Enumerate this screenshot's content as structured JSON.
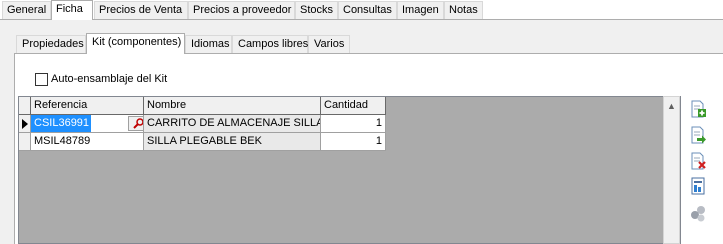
{
  "top_tabs": [
    {
      "label": "General"
    },
    {
      "label": "Ficha"
    },
    {
      "label": "Precios de Venta"
    },
    {
      "label": "Precios a proveedor"
    },
    {
      "label": "Stocks"
    },
    {
      "label": "Consultas"
    },
    {
      "label": "Imagen"
    },
    {
      "label": "Notas"
    }
  ],
  "inner_tabs": [
    {
      "label": "Propiedades"
    },
    {
      "label": "Kit (componentes)"
    },
    {
      "label": "Idiomas"
    },
    {
      "label": "Campos libres"
    },
    {
      "label": "Varios"
    }
  ],
  "auto_assembly": {
    "label": "Auto-ensamblaje del Kit",
    "checked": false
  },
  "grid": {
    "columns": [
      "Referencia",
      "Nombre",
      "Cantidad"
    ],
    "rows": [
      {
        "referencia": "CSIL36991",
        "nombre": "CARRITO DE ALMACENAJE SILLA",
        "cantidad": "1"
      },
      {
        "referencia": "MSIL48789",
        "nombre": "SILLA PLEGABLE BEK",
        "cantidad": "1"
      }
    ]
  },
  "toolbar": [
    {
      "icon": "add-document-icon"
    },
    {
      "icon": "edit-document-icon"
    },
    {
      "icon": "delete-document-icon"
    },
    {
      "icon": "report-icon"
    },
    {
      "icon": "components-icon"
    }
  ],
  "colors": {
    "selection": "#1e90ff",
    "panel_bg": "#f0f0f0",
    "grid_bg": "#ababab"
  }
}
